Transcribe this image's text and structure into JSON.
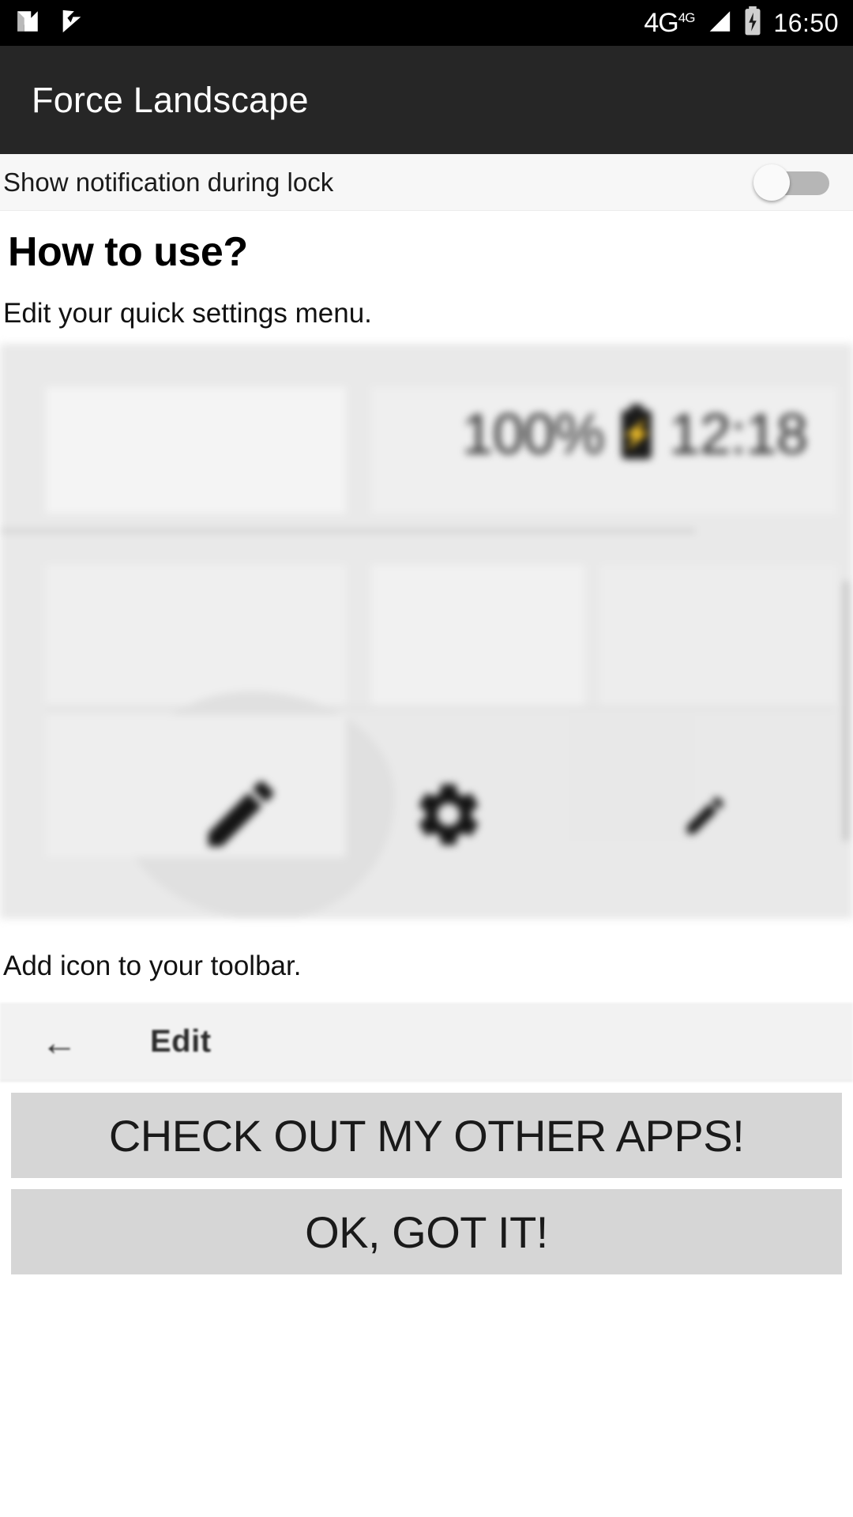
{
  "status_bar": {
    "icons": [
      {
        "name": "android-n-icon",
        "glyph": "N"
      },
      {
        "name": "app-check-flag-icon",
        "glyph": "V"
      }
    ],
    "network_label": "4G",
    "network_sup": "4G",
    "signal_icon": "signal-bars-icon",
    "battery_icon": "battery-charging-icon",
    "time": "16:50"
  },
  "app_bar": {
    "title": "Force Landscape"
  },
  "settings": {
    "notification_row": {
      "label": "Show notification during lock",
      "switch_state": "off"
    }
  },
  "howto": {
    "heading": "How to use?",
    "step_one_text": "Edit your quick settings menu.",
    "step_two_text": "Add icon to your toolbar."
  },
  "quick_settings_screenshot": {
    "battery_percent": "100%",
    "battery_icon": "battery-charging-icon",
    "clock": "12:18",
    "icons": [
      {
        "name": "pencil-edit-icon"
      },
      {
        "name": "gear-settings-icon"
      },
      {
        "name": "pencil-small-icon"
      }
    ]
  },
  "edit_toolbar_screenshot": {
    "back_icon": "arrow-left-icon",
    "title": "Edit"
  },
  "buttons": {
    "other_apps": "CHECK OUT MY OTHER APPS!",
    "got_it": "OK, GOT IT!"
  },
  "colors": {
    "status_bar_bg": "#000000",
    "app_bar_bg": "#262626",
    "page_bg": "#ffffff",
    "button_bg": "#d6d6d6",
    "switch_track_off": "#b6b6b6"
  }
}
